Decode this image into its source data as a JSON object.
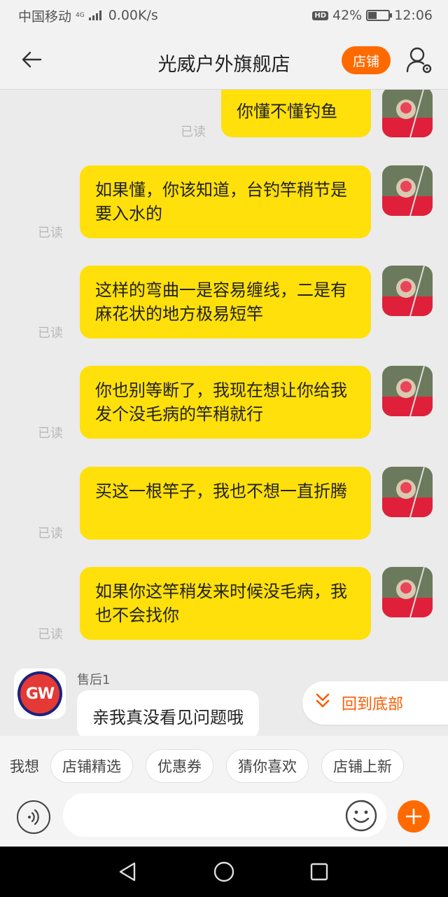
{
  "status": {
    "carrier": "中国移动",
    "network_type": "4G",
    "speed": "0.00K/s",
    "hd": "HD",
    "battery": "42%",
    "battery_level": 0.42,
    "time": "12:06"
  },
  "header": {
    "title": "光威户外旗舰店",
    "store_label": "店铺",
    "back_icon": "arrow-left-icon",
    "user_icon": "user-settings-icon"
  },
  "messages": [
    {
      "text": "你懂不懂钓鱼",
      "read": "已读"
    },
    {
      "text": "如果懂，你该知道，台钓竿稍节是要入水的",
      "read": "已读"
    },
    {
      "text": "这样的弯曲一是容易缠线，二是有麻花状的地方极易短竿",
      "read": "已读"
    },
    {
      "text": "你也别等断了，我现在想让你给我发个没毛病的竿稍就行",
      "read": "已读"
    },
    {
      "text": "买这一根竿子，我也不想一直折腾",
      "read": "已读"
    },
    {
      "text": "如果你这竿稍发来时候没毛病，我也不会找你",
      "read": "已读"
    }
  ],
  "incoming": {
    "avatar_text": "GW",
    "sender": "售后1",
    "text": "亲我真没看见问题哦"
  },
  "scroll_bottom": {
    "label": "回到底部",
    "icon": "double-chevron-down-icon"
  },
  "quick_replies": {
    "label": "我想",
    "items": [
      "店铺精选",
      "优惠券",
      "猜你喜欢",
      "店铺上新"
    ]
  },
  "input": {
    "placeholder": "",
    "voice_icon": "voice-icon",
    "emoji_icon": "smiley-icon",
    "plus_icon": "plus-icon"
  },
  "colors": {
    "accent": "#ff6a00",
    "bubble_out": "#ffe00a",
    "bubble_in": "#ffffff",
    "background": "#ebebeb"
  }
}
